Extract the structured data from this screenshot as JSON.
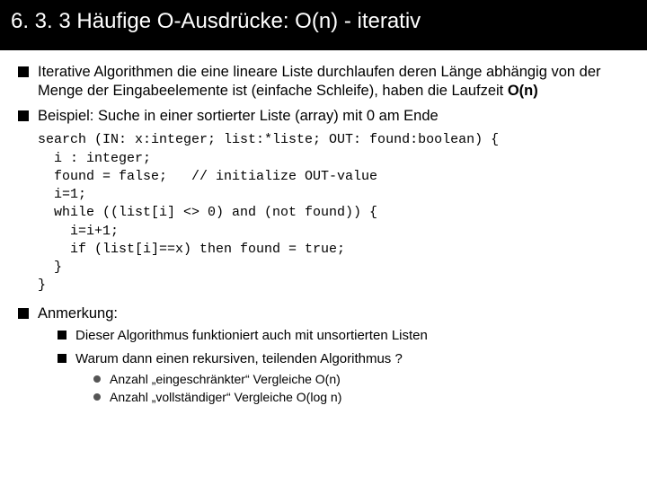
{
  "header": {
    "title": "6. 3. 3  Häufige O-Ausdrücke: O(n) - iterativ"
  },
  "bullets": {
    "b1": "Iterative Algorithmen die eine lineare Liste durchlaufen deren Länge abhängig von der Menge der Eingabeelemente ist (einfache Schleife), haben die Laufzeit ",
    "b1_bold": "O(n)",
    "b2": "Beispiel: Suche in einer sortierter Liste (array) mit 0 am Ende",
    "b3": "Anmerkung:",
    "sub1": "Dieser Algorithmus funktioniert auch mit unsortierten Listen",
    "sub2": "Warum dann einen rekursiven, teilenden Algorithmus ?",
    "d1": "Anzahl „eingeschränkter“ Vergleiche O(n)",
    "d2": "Anzahl „vollständiger“ Vergleiche O(log n)"
  },
  "code": "search (IN: x:integer; list:*liste; OUT: found:boolean) {\n  i : integer;\n  found = false;   // initialize OUT-value\n  i=1;\n  while ((list[i] <> 0) and (not found)) {\n    i=i+1;\n    if (list[i]==x) then found = true;\n  }\n}"
}
